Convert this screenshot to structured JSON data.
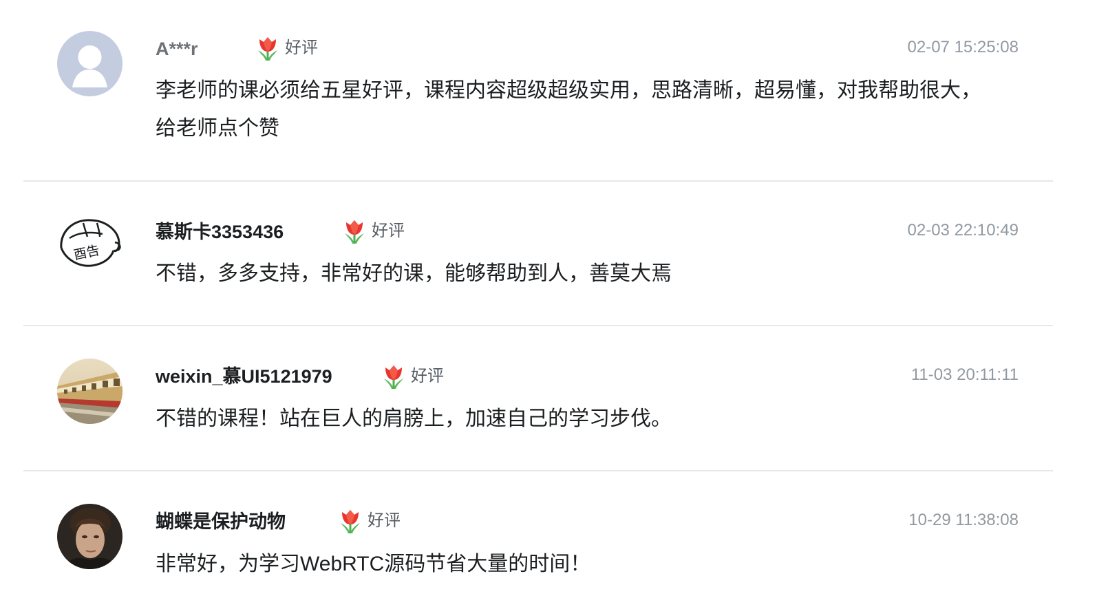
{
  "reviews": [
    {
      "username": "A***r",
      "badge": "好评",
      "time": "02-07 15:25:08",
      "content": "李老师的课必须给五星好评，课程内容超级超级实用，思路清晰，超易懂，对我帮助很大，给老师点个赞"
    },
    {
      "username": "慕斯卡3353436",
      "badge": "好评",
      "time": "02-03 22:10:49",
      "content": "不错，多多支持，非常好的课，能够帮助到人，善莫大焉"
    },
    {
      "username": "weixin_慕UI5121979",
      "badge": "好评",
      "time": "11-03 20:11:11",
      "content": "不错的课程！站在巨人的肩膀上，加速自己的学习步伐。"
    },
    {
      "username": "蝴蝶是保护动物",
      "badge": "好评",
      "time": "10-29 11:38:08",
      "content": "非常好，为学习WebRTC源码节省大量的时间！"
    }
  ],
  "avatar_doodle_text": "酉告",
  "colors": {
    "badge_flower": "#e8362f",
    "badge_leaf": "#4caf50",
    "time": "#9199a1",
    "divider": "#e6e7ea"
  },
  "icons": {
    "badge": "tulip-icon",
    "avatar_default": "default-avatar-icon"
  }
}
